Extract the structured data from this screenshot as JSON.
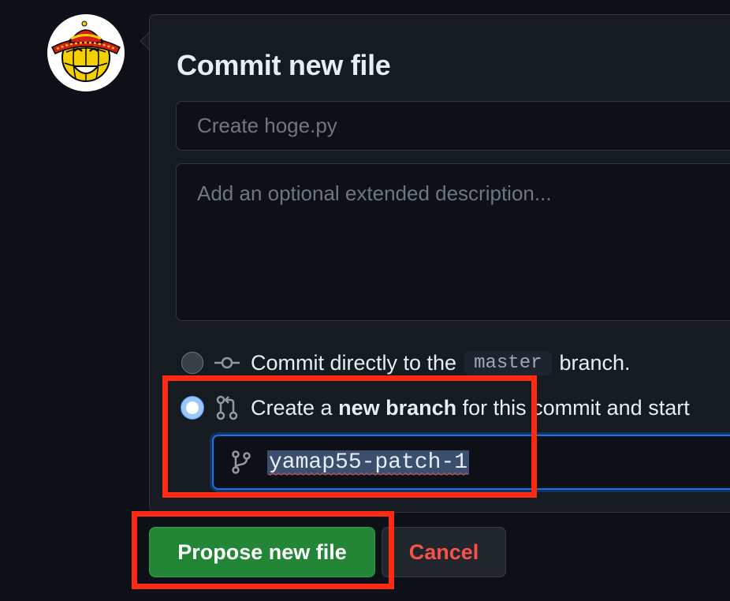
{
  "commit": {
    "title": "Commit new file",
    "summary_placeholder": "Create hoge.py",
    "description_placeholder": "Add an optional extended description..."
  },
  "options": {
    "direct": {
      "prefix": "Commit directly to the",
      "branch_code": "master",
      "suffix": "branch.",
      "selected": false,
      "icon": "git-commit-icon"
    },
    "new_branch": {
      "prefix": "Create a",
      "bold": "new branch",
      "suffix": "for this commit and start",
      "selected": true,
      "icon": "git-pull-request-icon"
    }
  },
  "branch_input": {
    "value": "yamap55-patch-1",
    "icon": "git-branch-icon"
  },
  "buttons": {
    "propose": "Propose new file",
    "cancel": "Cancel"
  },
  "colors": {
    "primary_button": "#238636",
    "cancel_text": "#f85149",
    "annotation": "#ff2a12",
    "focus": "#1f6feb"
  }
}
